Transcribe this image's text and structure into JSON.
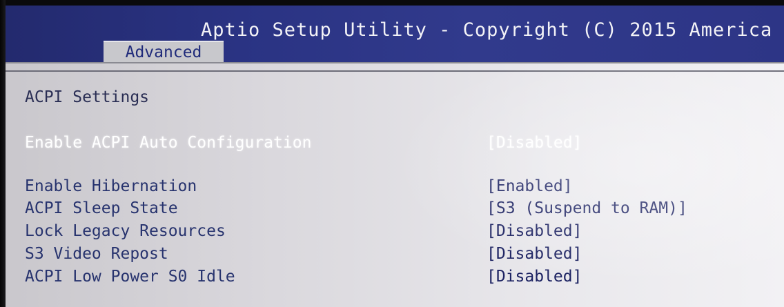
{
  "header": {
    "title": "Aptio Setup Utility - Copyright (C) 2015 America"
  },
  "tabs": [
    {
      "label": "Advanced",
      "active": true
    }
  ],
  "section": {
    "title": "ACPI Settings"
  },
  "settings": [
    {
      "label": "Enable ACPI Auto Configuration",
      "value": "[Disabled]",
      "selected": true
    },
    {
      "label": "Enable Hibernation",
      "value": "[Enabled]",
      "selected": false
    },
    {
      "label": "ACPI Sleep State",
      "value": "[S3 (Suspend to RAM)]",
      "selected": false
    },
    {
      "label": "Lock Legacy Resources",
      "value": "[Disabled]",
      "selected": false
    },
    {
      "label": "S3 Video Repost",
      "value": "[Disabled]",
      "selected": false
    },
    {
      "label": "ACPI Low Power S0 Idle",
      "value": "[Disabled]",
      "selected": false
    }
  ],
  "colors": {
    "header_bg": "#2a3383",
    "screen_bg": "#dad8dd",
    "selected_text": "#ffffff",
    "normal_text": "#27336e"
  }
}
